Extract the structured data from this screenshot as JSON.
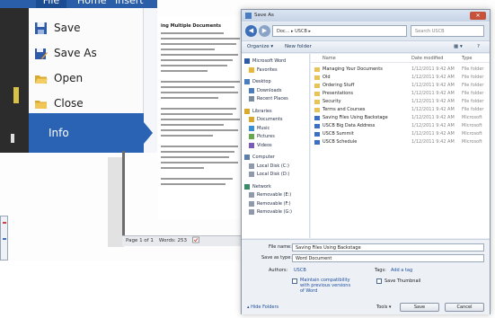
{
  "ribbon": {
    "tabs": [
      "File",
      "Home",
      "Insert"
    ]
  },
  "file_menu": {
    "items": [
      {
        "label": "Save",
        "icon": "save-icon"
      },
      {
        "label": "Save As",
        "icon": "save-as-icon"
      },
      {
        "label": "Open",
        "icon": "open-folder-icon"
      },
      {
        "label": "Close",
        "icon": "close-folder-icon"
      }
    ],
    "info_label": "Info"
  },
  "document": {
    "heading": "ing Multiple Documents"
  },
  "status_bar": {
    "page": "Page 1 of 1",
    "words": "Words: 253",
    "proofing_icon": "proofing-icon"
  },
  "dialog": {
    "title": "Save As",
    "address": "Doc... ▸ USCB ▸",
    "search_placeholder": "Search USCB",
    "toolbar": {
      "organize": "Organize ▾",
      "new_folder": "New folder"
    },
    "nav_items": [
      {
        "label": "Microsoft Word",
        "icon": "word-icon"
      },
      {
        "label": "Favorites",
        "icon": "star-icon"
      },
      {
        "label": "Desktop",
        "icon": "desktop-icon"
      },
      {
        "label": "Downloads",
        "icon": "downloads-icon"
      },
      {
        "label": "Recent Places",
        "icon": "recent-places-icon"
      },
      {
        "label": "Libraries",
        "icon": "libraries-icon"
      },
      {
        "label": "Documents",
        "icon": "documents-icon"
      },
      {
        "label": "Music",
        "icon": "music-icon"
      },
      {
        "label": "Pictures",
        "icon": "pictures-icon"
      },
      {
        "label": "Videos",
        "icon": "videos-icon"
      },
      {
        "label": "Computer",
        "icon": "computer-icon"
      },
      {
        "label": "Local Disk (C:)",
        "icon": "drive-icon"
      },
      {
        "label": "Local Disk (D:)",
        "icon": "drive-icon"
      },
      {
        "label": "Network",
        "icon": "network-icon"
      },
      {
        "label": "Removable (E:)",
        "icon": "drive-icon"
      },
      {
        "label": "Removable (F:)",
        "icon": "drive-icon"
      },
      {
        "label": "Removable (G:)",
        "icon": "drive-icon"
      }
    ],
    "columns": [
      "Name",
      "Date modified",
      "Type"
    ],
    "files": [
      {
        "name": "Managing Your Documents",
        "date": "1/12/2011 9:42 AM",
        "type": "File folder",
        "kind": "folder"
      },
      {
        "name": "Old",
        "date": "1/12/2011 9:42 AM",
        "type": "File folder",
        "kind": "folder"
      },
      {
        "name": "Ordering Stuff",
        "date": "1/12/2011 9:42 AM",
        "type": "File folder",
        "kind": "folder"
      },
      {
        "name": "Presentations",
        "date": "1/12/2011 9:42 AM",
        "type": "File folder",
        "kind": "folder"
      },
      {
        "name": "Security",
        "date": "1/12/2011 9:42 AM",
        "type": "File folder",
        "kind": "folder"
      },
      {
        "name": "Terms and Courses",
        "date": "1/12/2011 9:42 AM",
        "type": "File folder",
        "kind": "folder"
      },
      {
        "name": "Saving Files Using Backstage",
        "date": "1/12/2011 9:42 AM",
        "type": "Microsoft",
        "kind": "doc"
      },
      {
        "name": "USCB Big Data Address",
        "date": "1/12/2011 9:42 AM",
        "type": "Microsoft",
        "kind": "doc"
      },
      {
        "name": "USCB Summit",
        "date": "1/12/2011 9:42 AM",
        "type": "Microsoft",
        "kind": "doc"
      },
      {
        "name": "USCB Schedule",
        "date": "1/12/2011 9:42 AM",
        "type": "Microsoft",
        "kind": "doc"
      }
    ],
    "form": {
      "file_name_label": "File name:",
      "file_name_value": "Saving Files Using Backstage",
      "save_type_label": "Save as type:",
      "save_type_value": "Word Document",
      "authors_label": "Authors:",
      "authors_value": "USCB",
      "tags_label": "Tags:",
      "tags_value": "Add a tag",
      "compat_text": "Maintain compatibility with previous versions of Word",
      "thumbnail_label": "Save Thumbnail",
      "hide_folders": "▴ Hide Folders",
      "tools_label": "Tools ▾",
      "save_label": "Save",
      "cancel_label": "Cancel"
    }
  },
  "colors": {
    "accent": "#2a62b4",
    "ribbon": "#2a5ea8",
    "folder": "#e8c25a",
    "doc": "#3a6fc2"
  }
}
